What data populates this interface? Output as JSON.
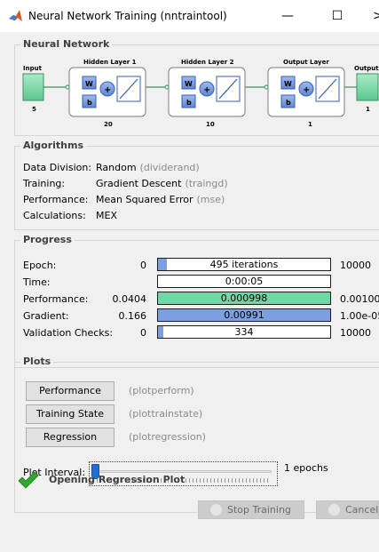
{
  "window": {
    "title": "Neural Network Training (nntraintool)",
    "minimize": "—",
    "maximize": "☐",
    "close": ">"
  },
  "network": {
    "group_label": "Neural Network",
    "input_label": "Input",
    "input_size": "5",
    "output_label": "Output",
    "output_size": "1",
    "layers": [
      {
        "title": "Hidden Layer 1",
        "size": "20"
      },
      {
        "title": "Hidden Layer 2",
        "size": "10"
      },
      {
        "title": "Output Layer",
        "size": "1"
      }
    ],
    "weight_symbol": "W",
    "bias_symbol": "b",
    "colors": {
      "input_green": "#7fd6a8",
      "block_blue": "#7b9fe0",
      "sum_blue": "#8aa6e6"
    }
  },
  "algorithms": {
    "group_label": "Algorithms",
    "rows": [
      {
        "key": "Data Division:",
        "value": "Random",
        "fn": "(dividerand)"
      },
      {
        "key": "Training:",
        "value": "Gradient Descent",
        "fn": "(traingd)"
      },
      {
        "key": "Performance:",
        "value": "Mean Squared Error",
        "fn": "(mse)"
      },
      {
        "key": "Calculations:",
        "value": "MEX",
        "fn": ""
      }
    ]
  },
  "progress": {
    "group_label": "Progress",
    "rows": [
      {
        "label": "Epoch:",
        "start": "0",
        "current": "495 iterations",
        "end": "10000",
        "fill": 0.05,
        "color": "#7b9fe0"
      },
      {
        "label": "Time:",
        "start": "",
        "current": "0:00:05",
        "end": "",
        "fill": 0,
        "color": "#7b9fe0"
      },
      {
        "label": "Performance:",
        "start": "0.0404",
        "current": "0.000998",
        "end": "0.00100",
        "fill": 1.0,
        "color": "#6fd8a4"
      },
      {
        "label": "Gradient:",
        "start": "0.166",
        "current": "0.00991",
        "end": "1.00e-05",
        "fill": 1.0,
        "color": "#7b9fe0"
      },
      {
        "label": "Validation Checks:",
        "start": "0",
        "current": "334",
        "end": "10000",
        "fill": 0.03,
        "color": "#7b9fe0"
      }
    ]
  },
  "plots": {
    "group_label": "Plots",
    "buttons": [
      {
        "label": "Performance",
        "fn": "(plotperform)"
      },
      {
        "label": "Training State",
        "fn": "(plottrainstate)"
      },
      {
        "label": "Regression",
        "fn": "(plotregression)"
      }
    ],
    "interval_label": "Plot Interval:",
    "interval_value": "1 epochs",
    "interval_level": 1
  },
  "status": {
    "text": "Opening Regression Plot"
  },
  "footer": {
    "stop_label": "Stop Training",
    "cancel_label": "Cancel"
  }
}
